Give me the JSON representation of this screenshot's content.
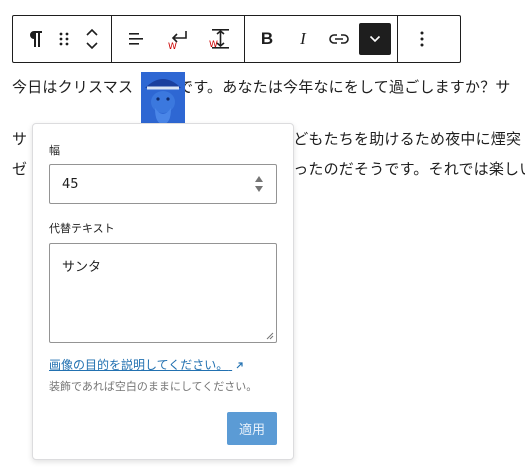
{
  "toolbar": {
    "icons": [
      "paragraph-icon",
      "drag-handle-icon",
      "move-up-down-icon",
      "align-left-icon",
      "wrap-icon",
      "height-icon",
      "bold-icon",
      "italic-icon",
      "link-icon",
      "more-rich-text-icon",
      "options-icon"
    ],
    "bold_label": "B",
    "italic_label": "I"
  },
  "content": {
    "line1_before": "今日はクリスマス",
    "line1_after": "です。あなたは今年なにをして過ごしますか？サ",
    "line2_start": "サ",
    "line2_end": "どもたちを助けるため夜中に煙突",
    "line3_start": "ゼ",
    "line3_end": "ったのだそうです。それでは楽しい"
  },
  "popover": {
    "width_label": "幅",
    "width_value": "45",
    "alt_label": "代替テキスト",
    "alt_value": "サンタ",
    "help_link": "画像の目的を説明してください。",
    "help_text": "装飾であれば空白のままにしてください。",
    "apply_label": "適用"
  },
  "colors": {
    "accent": "#2271b1",
    "image_bg": "#2e67d3",
    "apply_disabled": "#5b9bd5"
  }
}
